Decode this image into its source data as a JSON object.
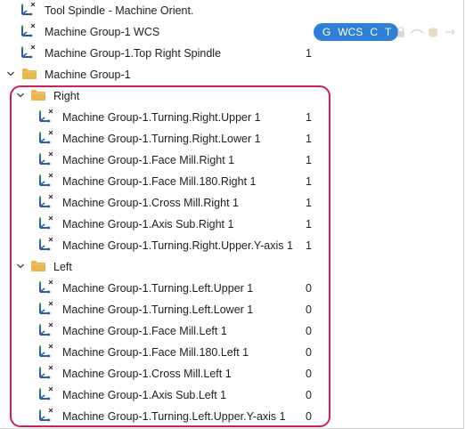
{
  "tree": {
    "rows": [
      {
        "label": "Tool Spindle - Machine Orient.",
        "value": "",
        "type": "axis",
        "level": 0
      },
      {
        "label": "Machine Group-1 WCS",
        "value": "",
        "type": "axis",
        "level": 0
      },
      {
        "label": "Machine Group-1.Top Right Spindle",
        "value": "1",
        "type": "axis",
        "level": 0
      },
      {
        "label": "Machine Group-1",
        "value": "",
        "type": "folder",
        "level": 0
      },
      {
        "label": "Right",
        "value": "",
        "type": "folder",
        "level": 1
      },
      {
        "label": "Machine Group-1.Turning.Right.Upper 1",
        "value": "1",
        "type": "axis",
        "level": 2
      },
      {
        "label": "Machine Group-1.Turning.Right.Lower 1",
        "value": "1",
        "type": "axis",
        "level": 2
      },
      {
        "label": "Machine Group-1.Face Mill.Right 1",
        "value": "1",
        "type": "axis",
        "level": 2
      },
      {
        "label": "Machine Group-1.Face Mill.180.Right 1",
        "value": "1",
        "type": "axis",
        "level": 2
      },
      {
        "label": "Machine Group-1.Cross Mill.Right 1",
        "value": "1",
        "type": "axis",
        "level": 2
      },
      {
        "label": "Machine Group-1.Axis Sub.Right 1",
        "value": "1",
        "type": "axis",
        "level": 2
      },
      {
        "label": "Machine Group-1.Turning.Right.Upper.Y-axis 1",
        "value": "1",
        "type": "axis",
        "level": 2
      },
      {
        "label": "Left",
        "value": "",
        "type": "folder",
        "level": 1
      },
      {
        "label": "Machine Group-1.Turning.Left.Upper 1",
        "value": "0",
        "type": "axis",
        "level": 2
      },
      {
        "label": "Machine Group-1.Turning.Left.Lower 1",
        "value": "0",
        "type": "axis",
        "level": 2
      },
      {
        "label": "Machine Group-1.Face Mill.Left 1",
        "value": "0",
        "type": "axis",
        "level": 2
      },
      {
        "label": "Machine Group-1.Face Mill.180.Left 1",
        "value": "0",
        "type": "axis",
        "level": 2
      },
      {
        "label": "Machine Group-1.Cross Mill.Left 1",
        "value": "0",
        "type": "axis",
        "level": 2
      },
      {
        "label": "Machine Group-1.Axis Sub.Left 1",
        "value": "0",
        "type": "axis",
        "level": 2
      },
      {
        "label": "Machine Group-1.Turning.Left.Upper.Y-axis 1",
        "value": "0",
        "type": "axis",
        "level": 2
      }
    ]
  },
  "wcs_badges": {
    "g": "G",
    "wcs": "WCS",
    "c": "C",
    "t": "T",
    "color": "#2f7fd4"
  },
  "icons": {
    "axis": "coordinate-axis-icon",
    "folder": "folder-icon",
    "chevron": "chevron-down-icon",
    "lock": "lock-icon",
    "eye": "eye-icon",
    "box": "box-icon"
  },
  "colors": {
    "highlight": "#c4245a",
    "folder": "#e8b64c",
    "axis_blue": "#2d5f9a",
    "axis_green": "#3a9a3a"
  }
}
